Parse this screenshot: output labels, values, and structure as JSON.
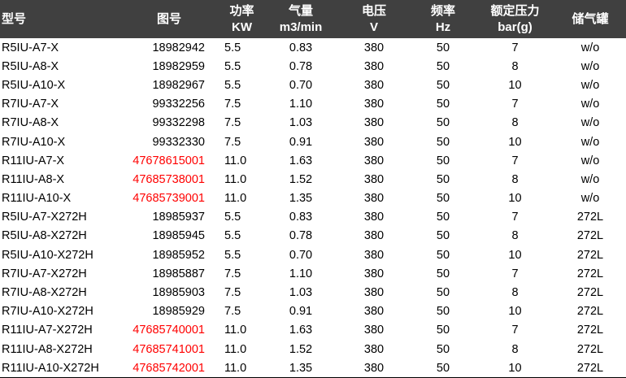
{
  "headers": {
    "model": [
      "型号"
    ],
    "part": [
      "图号"
    ],
    "power": [
      "功率",
      "KW"
    ],
    "flow": [
      "气量",
      "m3/min"
    ],
    "voltage": [
      "电压",
      "V"
    ],
    "freq": [
      "频率",
      "Hz"
    ],
    "pressure": [
      "额定压力",
      "bar(g)"
    ],
    "tank": [
      "储气罐"
    ]
  },
  "colors": {
    "header_bg": "#404040",
    "header_text": "#ffffff",
    "highlight_part": "#ff0000"
  },
  "rows": [
    {
      "model": "R5IU-A7-X",
      "part": "18982942",
      "part_red": false,
      "power": "5.5",
      "flow": "0.83",
      "voltage": "380",
      "freq": "50",
      "pressure": "7",
      "tank": "w/o"
    },
    {
      "model": "R5IU-A8-X",
      "part": "18982959",
      "part_red": false,
      "power": "5.5",
      "flow": "0.78",
      "voltage": "380",
      "freq": "50",
      "pressure": "8",
      "tank": "w/o"
    },
    {
      "model": "R5IU-A10-X",
      "part": "18982967",
      "part_red": false,
      "power": "5.5",
      "flow": "0.70",
      "voltage": "380",
      "freq": "50",
      "pressure": "10",
      "tank": "w/o"
    },
    {
      "model": "R7IU-A7-X",
      "part": "99332256",
      "part_red": false,
      "power": "7.5",
      "flow": "1.10",
      "voltage": "380",
      "freq": "50",
      "pressure": "7",
      "tank": "w/o"
    },
    {
      "model": "R7IU-A8-X",
      "part": "99332298",
      "part_red": false,
      "power": "7.5",
      "flow": "1.03",
      "voltage": "380",
      "freq": "50",
      "pressure": "8",
      "tank": "w/o"
    },
    {
      "model": "R7IU-A10-X",
      "part": "99332330",
      "part_red": false,
      "power": "7.5",
      "flow": "0.91",
      "voltage": "380",
      "freq": "50",
      "pressure": "10",
      "tank": "w/o"
    },
    {
      "model": "R11IU-A7-X",
      "part": "47678615001",
      "part_red": true,
      "power": "11.0",
      "flow": "1.63",
      "voltage": "380",
      "freq": "50",
      "pressure": "7",
      "tank": "w/o"
    },
    {
      "model": "R11IU-A8-X",
      "part": "47685738001",
      "part_red": true,
      "power": "11.0",
      "flow": "1.52",
      "voltage": "380",
      "freq": "50",
      "pressure": "8",
      "tank": "w/o"
    },
    {
      "model": "R11IU-A10-X",
      "part": "47685739001",
      "part_red": true,
      "power": "11.0",
      "flow": "1.35",
      "voltage": "380",
      "freq": "50",
      "pressure": "10",
      "tank": "w/o"
    },
    {
      "model": "R5IU-A7-X272H",
      "part": "18985937",
      "part_red": false,
      "power": "5.5",
      "flow": "0.83",
      "voltage": "380",
      "freq": "50",
      "pressure": "7",
      "tank": "272L"
    },
    {
      "model": "R5IU-A8-X272H",
      "part": "18985945",
      "part_red": false,
      "power": "5.5",
      "flow": "0.78",
      "voltage": "380",
      "freq": "50",
      "pressure": "8",
      "tank": "272L"
    },
    {
      "model": "R5IU-A10-X272H",
      "part": "18985952",
      "part_red": false,
      "power": "5.5",
      "flow": "0.70",
      "voltage": "380",
      "freq": "50",
      "pressure": "10",
      "tank": "272L"
    },
    {
      "model": "R7IU-A7-X272H",
      "part": "18985887",
      "part_red": false,
      "power": "7.5",
      "flow": "1.10",
      "voltage": "380",
      "freq": "50",
      "pressure": "7",
      "tank": "272L"
    },
    {
      "model": "R7IU-A8-X272H",
      "part": "18985903",
      "part_red": false,
      "power": "7.5",
      "flow": "1.03",
      "voltage": "380",
      "freq": "50",
      "pressure": "8",
      "tank": "272L"
    },
    {
      "model": "R7IU-A10-X272H",
      "part": "18985929",
      "part_red": false,
      "power": "7.5",
      "flow": "0.91",
      "voltage": "380",
      "freq": "50",
      "pressure": "10",
      "tank": "272L"
    },
    {
      "model": "R11IU-A7-X272H",
      "part": "47685740001",
      "part_red": true,
      "power": "11.0",
      "flow": "1.63",
      "voltage": "380",
      "freq": "50",
      "pressure": "7",
      "tank": "272L"
    },
    {
      "model": "R11IU-A8-X272H",
      "part": "47685741001",
      "part_red": true,
      "power": "11.0",
      "flow": "1.52",
      "voltage": "380",
      "freq": "50",
      "pressure": "8",
      "tank": "272L"
    },
    {
      "model": "R11IU-A10-X272H",
      "part": "47685742001",
      "part_red": true,
      "power": "11.0",
      "flow": "1.35",
      "voltage": "380",
      "freq": "50",
      "pressure": "10",
      "tank": "272L"
    }
  ]
}
